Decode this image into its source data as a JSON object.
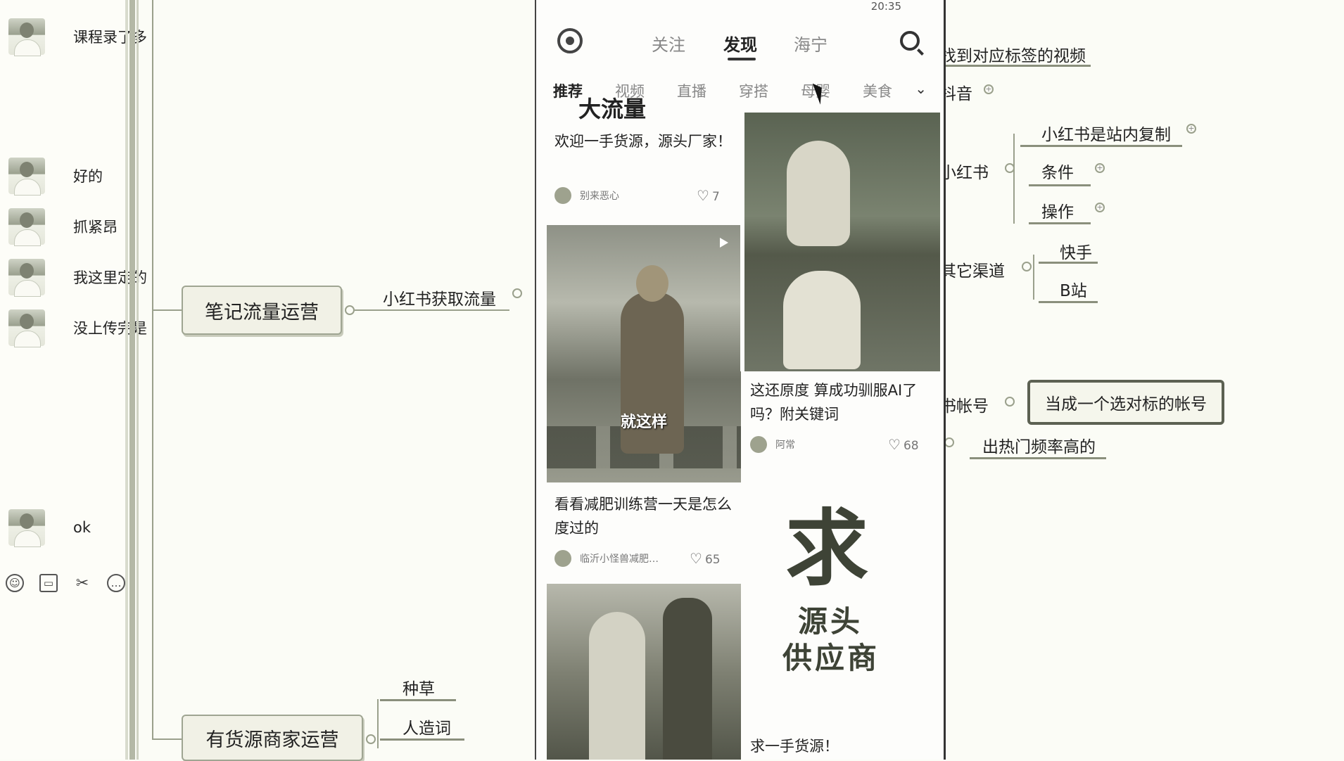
{
  "chat": {
    "messages": [
      {
        "text": "课程录了多"
      },
      {
        "text": "好的"
      },
      {
        "text": "抓紧昂"
      },
      {
        "text": "我这里定的"
      },
      {
        "text": "没上传完是"
      },
      {
        "text": "ok"
      }
    ],
    "tools": [
      "emoji-icon",
      "folder-icon",
      "scissors-icon",
      "chat-bubble-icon"
    ]
  },
  "mindmap": {
    "node_notes": "笔记流量运营",
    "node_goods": "有货源商家运营",
    "branch_xhs_traffic": "小红书获取流量",
    "branch_zhongcao": "种草",
    "branch_rencaoci": "人造词",
    "find_videos": "找到对应标签的视频",
    "douyin": "抖音",
    "xiaohongshu": "小红书",
    "xhs_copy": "小红书是站内复制",
    "conditions": "条件",
    "operations": "操作",
    "other_channels": "其它渠道",
    "kuaishou": "快手",
    "bilibili": "B站",
    "account_label": "书帐号",
    "benchmark_account": "当成一个选对标的帐号",
    "hot_frequency": "出热门频率高的"
  },
  "phone": {
    "status": "20:35",
    "top_tabs": [
      "关注",
      "发现",
      "海宁"
    ],
    "active_top_tab": "发现",
    "categories": [
      "推荐",
      "视频",
      "直播",
      "穿搭",
      "母婴",
      "美食"
    ],
    "active_category": "推荐",
    "cards": {
      "card1": {
        "header_fragment": "大流量",
        "title": "欢迎一手货源，源头厂家！",
        "author": "别来恶心",
        "likes": "7"
      },
      "card2": {
        "title": "这还原度 算成功驯服AI了吗？附关键词",
        "author": "阿常",
        "likes": "68"
      },
      "card3": {
        "overlay": "就这样",
        "title": "看看减肥训练营一天是怎么度过的",
        "author": "临沂小怪兽减肥…",
        "likes": "65"
      },
      "card4": {
        "big_char": "求",
        "line1": "源头",
        "line2": "供应商",
        "title": "求一手货源！"
      }
    }
  },
  "colors": {
    "background": "#fbfcf6",
    "node_border": "#9fa592",
    "accent_dark": "#3e4336"
  }
}
